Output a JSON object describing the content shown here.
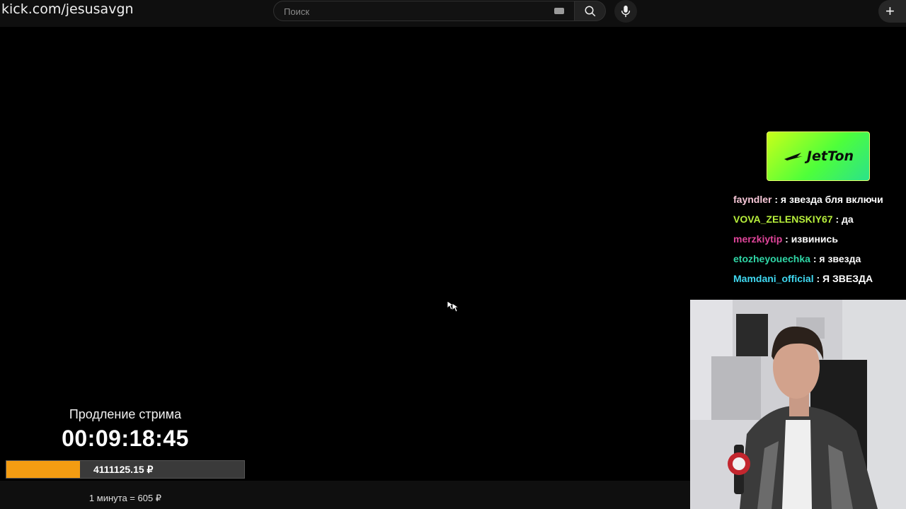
{
  "browser": {
    "url": "kick.com/jesusavgn"
  },
  "search": {
    "placeholder": "Поиск"
  },
  "header": {
    "create_label": "+"
  },
  "sponsor": {
    "name": "JetTon"
  },
  "chat": {
    "messages": [
      {
        "user": "fayndler",
        "text": " : я звезда бля включи",
        "color": "#f5c6d6"
      },
      {
        "user": "VOVA_ZELENSKIY67",
        "text": " : да",
        "color": "#b8f03c"
      },
      {
        "user": "merzkiytip",
        "text": " : извинись",
        "color": "#e0459a"
      },
      {
        "user": "etozheyouechka",
        "text": " : я звезда",
        "color": "#2fd6a6"
      },
      {
        "user": "Mamdani_official",
        "text": " : Я ЗВЕЗДА",
        "color": "#3fd8f0"
      }
    ]
  },
  "stream_extension": {
    "label": "Продление стрима",
    "timer": "00:09:18:45",
    "amount": "4111125.15 ₽",
    "progress_fraction": 0.31,
    "rate": "1 минута = 605 ₽",
    "accent_color": "#f39c12"
  }
}
